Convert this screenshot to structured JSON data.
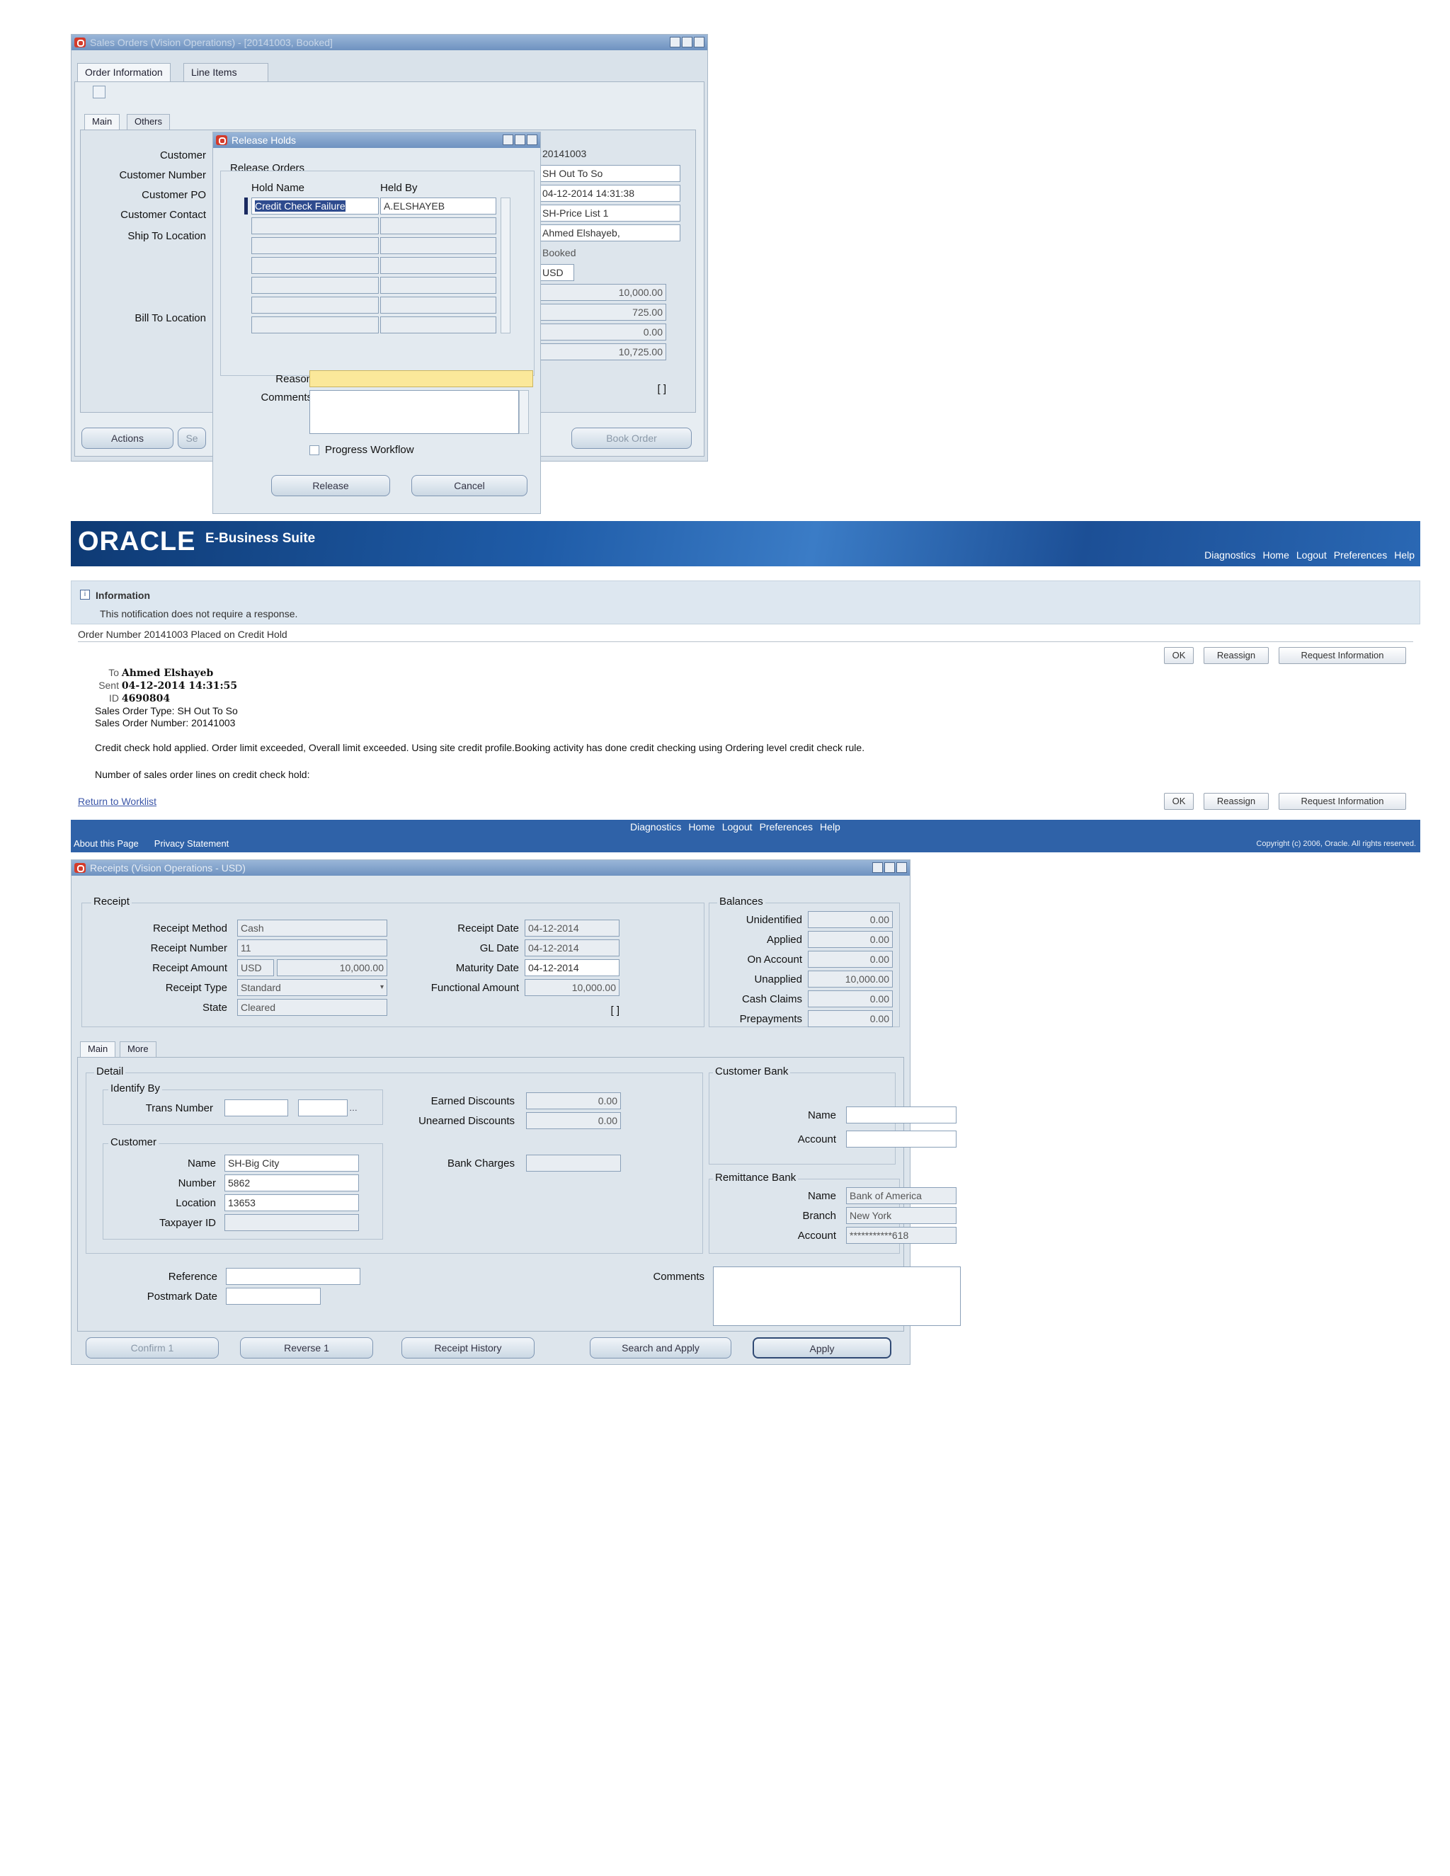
{
  "window1": {
    "title": "Sales Orders (Vision Operations) - [20141003, Booked]",
    "tabs": [
      "Order Information",
      "Line Items"
    ],
    "subtabs": [
      "Main",
      "Others"
    ],
    "labels": [
      "Customer",
      "Customer Number",
      "Customer PO",
      "Customer Contact",
      "Ship To Location",
      "Bill To Location"
    ],
    "right_values": [
      "20141003",
      "SH Out To So",
      "04-12-2014 14:31:38",
      "SH-Price List 1",
      "Ahmed Elshayeb,",
      "Booked",
      "USD",
      "10,000.00",
      "725.00",
      "0.00",
      "10,725.00",
      "[ ]"
    ],
    "buttons": [
      "Actions",
      "Se",
      "Book Order"
    ]
  },
  "dialog": {
    "title": "Release Holds",
    "section": "Release Orders",
    "col_hold_name": "Hold Name",
    "col_held_by": "Held By",
    "row_hold_name": "Credit Check Failure",
    "row_held_by": "A.ELSHAYEB",
    "reason_label": "Reason",
    "comments_label": "Comments",
    "progress_label": "Progress Workflow",
    "release_btn": "Release",
    "cancel_btn": "Cancel"
  },
  "oracle": {
    "logo": "ORACLE",
    "product": "E-Business Suite",
    "nav": [
      "Diagnostics",
      "Home",
      "Logout",
      "Preferences",
      "Help"
    ],
    "info_title": "Information",
    "info_text": "This notification does not require a response.",
    "subject": "Order Number 20141003 Placed on Credit Hold",
    "btn_ok": "OK",
    "btn_reassign": "Reassign",
    "btn_request": "Request Information",
    "to_label": "To",
    "to_value": "Ahmed Elshayeb",
    "sent_label": "Sent",
    "sent_value": "04-12-2014 14:31:55",
    "id_label": "ID",
    "id_value": "4690804",
    "order_type": "Sales Order Type: SH Out To So",
    "order_number": "Sales Order Number: 20141003",
    "message": "Credit check hold applied. Order limit exceeded, Overall limit exceeded. Using site credit profile.Booking activity has done credit checking using Ordering level credit check rule.",
    "lines_text": "Number of sales order lines on credit check hold:",
    "return_link": "Return to Worklist",
    "footer_nav": [
      "Diagnostics",
      "Home",
      "Logout",
      "Preferences",
      "Help"
    ],
    "footer_left": [
      "About this Page",
      "Privacy Statement"
    ],
    "copyright": "Copyright (c) 2006, Oracle. All rights reserved."
  },
  "receipts": {
    "title": "Receipts (Vision Operations - USD)",
    "receipt_group": "Receipt",
    "receipt_method_label": "Receipt Method",
    "receipt_method": "Cash",
    "receipt_number_label": "Receipt Number",
    "receipt_number": "11",
    "receipt_amount_label": "Receipt Amount",
    "currency": "USD",
    "receipt_amount": "10,000.00",
    "receipt_type_label": "Receipt Type",
    "receipt_type": "Standard",
    "state_label": "State",
    "state": "Cleared",
    "receipt_date_label": "Receipt Date",
    "receipt_date": "04-12-2014",
    "gl_date_label": "GL Date",
    "gl_date": "04-12-2014",
    "maturity_date_label": "Maturity Date",
    "maturity_date": "04-12-2014",
    "functional_amount_label": "Functional Amount",
    "functional_amount": "10,000.00",
    "flex": "[ ]",
    "balances_group": "Balances",
    "balances": [
      {
        "label": "Unidentified",
        "value": "0.00"
      },
      {
        "label": "Applied",
        "value": "0.00"
      },
      {
        "label": "On Account",
        "value": "0.00"
      },
      {
        "label": "Unapplied",
        "value": "10,000.00"
      },
      {
        "label": "Cash Claims",
        "value": "0.00"
      },
      {
        "label": "Prepayments",
        "value": "0.00"
      }
    ],
    "tabs": [
      "Main",
      "More"
    ],
    "detail": "Detail",
    "identify_by": "Identify By",
    "trans_number_label": "Trans Number",
    "earned_label": "Earned Discounts",
    "earned": "0.00",
    "unearned_label": "Unearned Discounts",
    "unearned": "0.00",
    "bank_charges_label": "Bank Charges",
    "customer_group": "Customer",
    "name_label": "Name",
    "customer_name": "SH-Big City",
    "number_label": "Number",
    "customer_number": "5862",
    "location_label": "Location",
    "customer_location": "13653",
    "taxpayer_label": "Taxpayer ID",
    "customer_bank_group": "Customer Bank",
    "cb_name_label": "Name",
    "cb_account_label": "Account",
    "remit_group": "Remittance Bank",
    "rb_name_label": "Name",
    "rb_name": "Bank of America",
    "rb_branch_label": "Branch",
    "rb_branch": "New York",
    "rb_account_label": "Account",
    "rb_account": "***********618",
    "reference_label": "Reference",
    "postmark_label": "Postmark Date",
    "comments_label": "Comments",
    "buttons": [
      "Confirm",
      "Reverse",
      "Receipt History",
      "Search and Apply",
      "Apply"
    ],
    "confirm_count": "1",
    "reverse_count": "1"
  }
}
